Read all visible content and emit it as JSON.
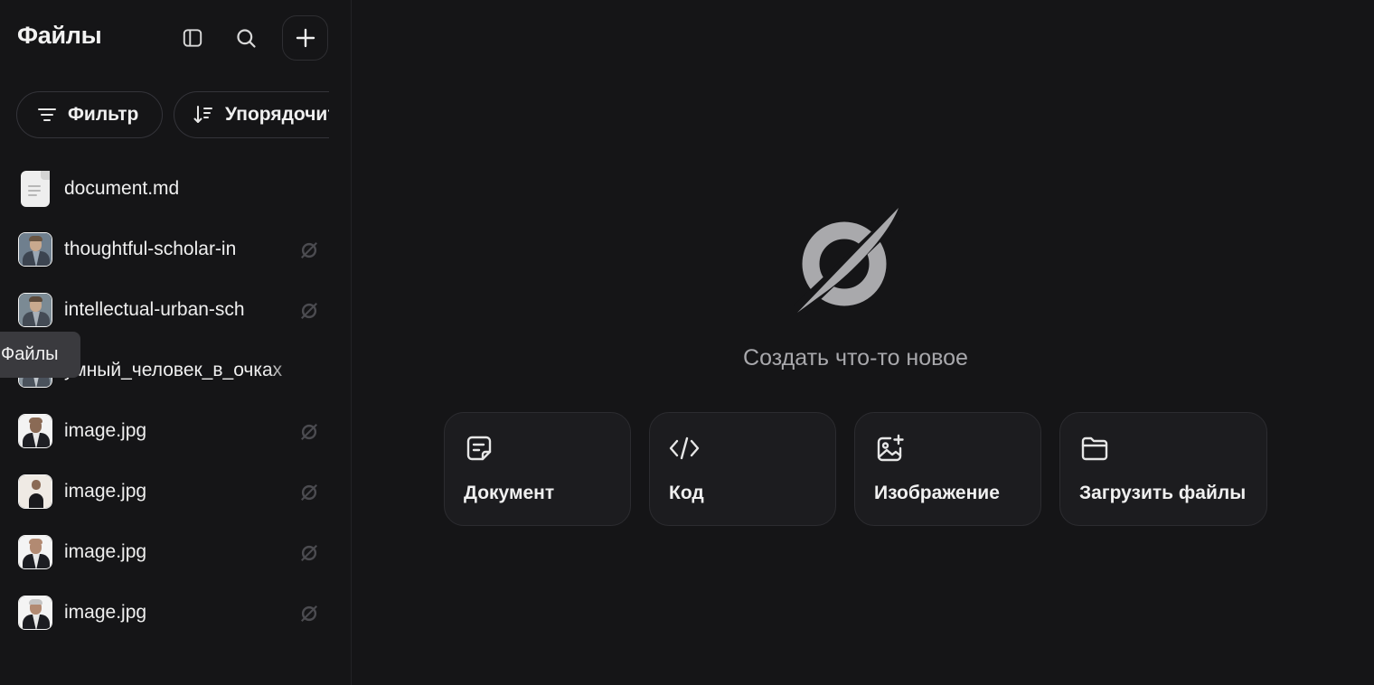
{
  "sidebar": {
    "title": "Файлы",
    "filter_label": "Фильтр",
    "sort_label": "Упорядочить",
    "files": [
      {
        "name": "document.md",
        "kind": "document"
      },
      {
        "name": "thoughtful-scholar-in",
        "kind": "image"
      },
      {
        "name": "intellectual-urban-sch",
        "kind": "image"
      },
      {
        "name": "умный_человек_в_очках",
        "kind": "image"
      },
      {
        "name": "image.jpg",
        "kind": "image"
      },
      {
        "name": "image.jpg",
        "kind": "image"
      },
      {
        "name": "image.jpg",
        "kind": "image"
      },
      {
        "name": "image.jpg",
        "kind": "image"
      }
    ]
  },
  "tooltip": {
    "text": "Файлы"
  },
  "main": {
    "empty_title": "Создать что-то новое",
    "cards": [
      {
        "label": "Документ",
        "icon": "document-icon"
      },
      {
        "label": "Код",
        "icon": "code-icon"
      },
      {
        "label": "Изображение",
        "icon": "image-plus-icon"
      },
      {
        "label": "Загрузить файлы",
        "icon": "folder-icon"
      }
    ]
  },
  "colors": {
    "background": "#151517",
    "card_background": "#1c1c1f",
    "border": "#2c2c30",
    "text": "#efefef",
    "muted_text": "#a8a8ac",
    "tooltip_background": "#3a3a3e"
  }
}
